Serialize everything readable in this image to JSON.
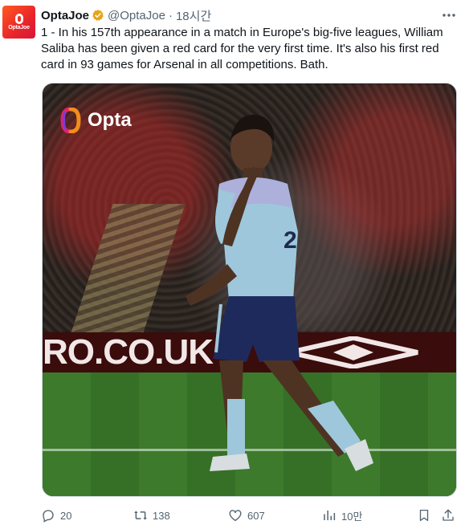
{
  "author": {
    "display_name": "OptaJoe",
    "handle": "@OptaJoe",
    "time_ago": "18시간",
    "avatar_text": "OptaJoe",
    "verified_color": "#e8a317"
  },
  "tweet": {
    "text": "1 - In his 157th appearance in a match in Europe's big-five leagues, William Saliba has been given a red card for the very first time. It's also his first red card in 93 games for Arsenal in all competitions. Bath."
  },
  "media": {
    "logo_text": "Opta",
    "ad_board_text": "RO.CO.UK",
    "jersey_number": "2"
  },
  "actions": {
    "replies": "20",
    "reposts": "138",
    "likes": "607",
    "views": "10만"
  },
  "colors": {
    "text_primary": "#0f1419",
    "text_secondary": "#536471",
    "border": "#cfd9de"
  }
}
